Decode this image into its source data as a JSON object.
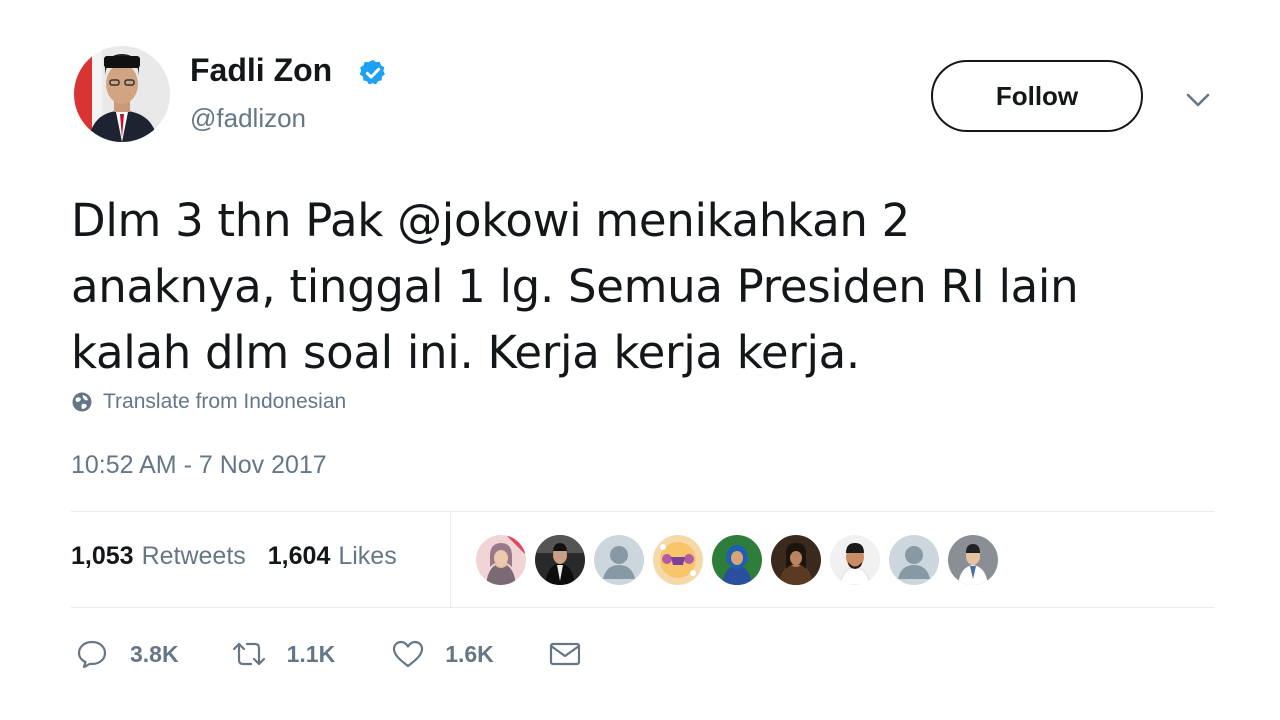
{
  "author": {
    "display_name": "Fadli Zon",
    "handle": "@fadlizon",
    "verified": true,
    "avatar_icon": "profile-photo"
  },
  "header": {
    "follow_label": "Follow",
    "menu_icon": "chevron-down-icon"
  },
  "tweet": {
    "lines": [
      "Dlm 3 thn Pak @jokowi menikahkan 2",
      "anaknya, tinggal 1 lg. Semua Presiden RI lain",
      "kalah dlm soal ini. Kerja kerja kerja."
    ],
    "translate_label": "Translate from Indonesian",
    "timestamp": "10:52 AM - 7 Nov 2017"
  },
  "stats": {
    "retweets_count": "1,053",
    "retweets_label": "Retweets",
    "likes_count": "1,604",
    "likes_label": "Likes"
  },
  "liked_by": [
    "liker-avatar-1",
    "liker-avatar-2",
    "liker-avatar-3",
    "liker-avatar-4",
    "liker-avatar-5",
    "liker-avatar-6",
    "liker-avatar-7",
    "liker-avatar-8",
    "liker-avatar-9"
  ],
  "actions": {
    "reply_count": "3.8K",
    "retweet_count": "1.1K",
    "like_count": "1.6K"
  },
  "colors": {
    "text": "#14171a",
    "secondary": "#657786",
    "verified": "#1da1f2",
    "divider": "#e6ecf0"
  }
}
